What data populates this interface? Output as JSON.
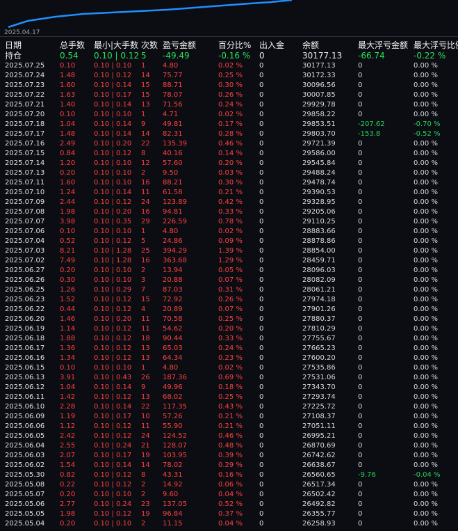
{
  "chart": {
    "start_date": "2025.04.17",
    "line_color": "#1e90ff"
  },
  "colors": {
    "background": "#0b0d12",
    "profit": "#ff4040",
    "loss": "#28e05a"
  },
  "headers": [
    "日期",
    "总手数",
    "最小|大手数",
    "次数",
    "盈亏金额",
    "百分比%",
    "出入金",
    "余额",
    "最大浮亏金额",
    "最大浮亏比例"
  ],
  "hold_row": {
    "date": "持仓",
    "lots": "0.54",
    "minmax": "0.10 | 0.12",
    "count": "5",
    "pnl": "-49.49",
    "pct": "-0.16 %",
    "io": "0",
    "balance": "30177.13",
    "max_float_loss": "-66.74",
    "max_float_ratio": "-0.22 %"
  },
  "rows": [
    [
      "2025.07.25",
      "0.10",
      "0.10 | 0.10",
      "1",
      "4.80",
      "0.02 %",
      "0",
      "30177.13",
      "0",
      "0.00 %"
    ],
    [
      "2025.07.24",
      "1.48",
      "0.10 | 0.12",
      "14",
      "75.77",
      "0.25 %",
      "0",
      "30172.33",
      "0",
      "0.00 %"
    ],
    [
      "2025.07.23",
      "1.60",
      "0.10 | 0.14",
      "15",
      "88.71",
      "0.30 %",
      "0",
      "30096.56",
      "0",
      "0.00 %"
    ],
    [
      "2025.07.22",
      "1.63",
      "0.10 | 0.17",
      "15",
      "78.07",
      "0.26 %",
      "0",
      "30007.85",
      "0",
      "0.00 %"
    ],
    [
      "2025.07.21",
      "1.40",
      "0.10 | 0.14",
      "13",
      "71.56",
      "0.24 %",
      "0",
      "29929.78",
      "0",
      "0.00 %"
    ],
    [
      "2025.07.20",
      "0.10",
      "0.10 | 0.10",
      "1",
      "4.71",
      "0.02 %",
      "0",
      "29858.22",
      "0",
      "0.00 %"
    ],
    [
      "2025.07.18",
      "1.04",
      "0.10 | 0.14",
      "9",
      "49.81",
      "0.17 %",
      "0",
      "29853.51",
      "-207.62",
      "-0.70 %"
    ],
    [
      "2025.07.17",
      "1.48",
      "0.10 | 0.14",
      "14",
      "82.31",
      "0.28 %",
      "0",
      "29803.70",
      "-153.8",
      "-0.52 %"
    ],
    [
      "2025.07.16",
      "2.49",
      "0.10 | 0.20",
      "22",
      "135.39",
      "0.46 %",
      "0",
      "29721.39",
      "0",
      "0.00 %"
    ],
    [
      "2025.07.15",
      "0.84",
      "0.10 | 0.12",
      "8",
      "40.16",
      "0.14 %",
      "0",
      "29586.00",
      "0",
      "0.00 %"
    ],
    [
      "2025.07.14",
      "1.20",
      "0.10 | 0.10",
      "12",
      "57.60",
      "0.20 %",
      "0",
      "29545.84",
      "0",
      "0.00 %"
    ],
    [
      "2025.07.13",
      "0.20",
      "0.10 | 0.10",
      "2",
      "9.50",
      "0.03 %",
      "0",
      "29488.24",
      "0",
      "0.00 %"
    ],
    [
      "2025.07.11",
      "1.60",
      "0.10 | 0.10",
      "16",
      "88.21",
      "0.30 %",
      "0",
      "29478.74",
      "0",
      "0.00 %"
    ],
    [
      "2025.07.10",
      "1.24",
      "0.10 | 0.14",
      "11",
      "61.58",
      "0.21 %",
      "0",
      "29390.53",
      "0",
      "0.00 %"
    ],
    [
      "2025.07.09",
      "2.44",
      "0.10 | 0.12",
      "24",
      "123.89",
      "0.42 %",
      "0",
      "29328.95",
      "0",
      "0.00 %"
    ],
    [
      "2025.07.08",
      "1.98",
      "0.10 | 0.20",
      "16",
      "94.81",
      "0.33 %",
      "0",
      "29205.06",
      "0",
      "0.00 %"
    ],
    [
      "2025.07.07",
      "3.98",
      "0.10 | 0.35",
      "29",
      "226.59",
      "0.78 %",
      "0",
      "29110.25",
      "0",
      "0.00 %"
    ],
    [
      "2025.07.06",
      "0.10",
      "0.10 | 0.10",
      "1",
      "4.80",
      "0.02 %",
      "0",
      "28883.66",
      "0",
      "0.00 %"
    ],
    [
      "2025.07.04",
      "0.52",
      "0.10 | 0.12",
      "5",
      "24.86",
      "0.09 %",
      "0",
      "28878.86",
      "0",
      "0.00 %"
    ],
    [
      "2025.07.03",
      "8.21",
      "0.10 | 1.28",
      "25",
      "394.29",
      "1.39 %",
      "0",
      "28854.00",
      "0",
      "0.00 %"
    ],
    [
      "2025.07.02",
      "7.49",
      "0.10 | 1.28",
      "16",
      "363.68",
      "1.29 %",
      "0",
      "28459.71",
      "0",
      "0.00 %"
    ],
    [
      "2025.06.27",
      "0.20",
      "0.10 | 0.10",
      "2",
      "13.94",
      "0.05 %",
      "0",
      "28096.03",
      "0",
      "0.00 %"
    ],
    [
      "2025.06.26",
      "0.30",
      "0.10 | 0.10",
      "3",
      "20.88",
      "0.07 %",
      "0",
      "28082.09",
      "0",
      "0.00 %"
    ],
    [
      "2025.06.25",
      "1.26",
      "0.10 | 0.29",
      "7",
      "87.03",
      "0.31 %",
      "0",
      "28061.21",
      "0",
      "0.00 %"
    ],
    [
      "2025.06.23",
      "1.52",
      "0.10 | 0.12",
      "15",
      "72.92",
      "0.26 %",
      "0",
      "27974.18",
      "0",
      "0.00 %"
    ],
    [
      "2025.06.22",
      "0.44",
      "0.10 | 0.12",
      "4",
      "20.89",
      "0.07 %",
      "0",
      "27901.26",
      "0",
      "0.00 %"
    ],
    [
      "2025.06.20",
      "1.46",
      "0.10 | 0.20",
      "11",
      "70.58",
      "0.25 %",
      "0",
      "27880.37",
      "0",
      "0.00 %"
    ],
    [
      "2025.06.19",
      "1.14",
      "0.10 | 0.12",
      "11",
      "54.62",
      "0.20 %",
      "0",
      "27810.29",
      "0",
      "0.00 %"
    ],
    [
      "2025.06.18",
      "1.88",
      "0.10 | 0.12",
      "18",
      "90.44",
      "0.33 %",
      "0",
      "27755.67",
      "0",
      "0.00 %"
    ],
    [
      "2025.06.17",
      "1.36",
      "0.10 | 0.12",
      "13",
      "65.03",
      "0.24 %",
      "0",
      "27665.23",
      "0",
      "0.00 %"
    ],
    [
      "2025.06.16",
      "1.34",
      "0.10 | 0.12",
      "13",
      "64.34",
      "0.23 %",
      "0",
      "27600.20",
      "0",
      "0.00 %"
    ],
    [
      "2025.06.15",
      "0.10",
      "0.10 | 0.10",
      "1",
      "4.80",
      "0.02 %",
      "0",
      "27535.86",
      "0",
      "0.00 %"
    ],
    [
      "2025.06.13",
      "3.91",
      "0.10 | 0.43",
      "26",
      "187.36",
      "0.69 %",
      "0",
      "27531.06",
      "0",
      "0.00 %"
    ],
    [
      "2025.06.12",
      "1.04",
      "0.10 | 0.14",
      "9",
      "49.96",
      "0.18 %",
      "0",
      "27343.70",
      "0",
      "0.00 %"
    ],
    [
      "2025.06.11",
      "1.42",
      "0.10 | 0.12",
      "13",
      "68.02",
      "0.25 %",
      "0",
      "27293.74",
      "0",
      "0.00 %"
    ],
    [
      "2025.06.10",
      "2.28",
      "0.10 | 0.14",
      "22",
      "117.35",
      "0.43 %",
      "0",
      "27225.72",
      "0",
      "0.00 %"
    ],
    [
      "2025.06.09",
      "1.19",
      "0.10 | 0.17",
      "10",
      "57.26",
      "0.21 %",
      "0",
      "27108.37",
      "0",
      "0.00 %"
    ],
    [
      "2025.06.06",
      "1.12",
      "0.10 | 0.12",
      "11",
      "55.90",
      "0.21 %",
      "0",
      "27051.11",
      "0",
      "0.00 %"
    ],
    [
      "2025.06.05",
      "2.42",
      "0.10 | 0.12",
      "24",
      "124.52",
      "0.46 %",
      "0",
      "26995.21",
      "0",
      "0.00 %"
    ],
    [
      "2025.06.04",
      "2.55",
      "0.10 | 0.24",
      "21",
      "128.07",
      "0.48 %",
      "0",
      "26870.69",
      "0",
      "0.00 %"
    ],
    [
      "2025.06.03",
      "2.07",
      "0.10 | 0.17",
      "19",
      "103.95",
      "0.39 %",
      "0",
      "26742.62",
      "0",
      "0.00 %"
    ],
    [
      "2025.06.02",
      "1.54",
      "0.10 | 0.14",
      "14",
      "78.02",
      "0.29 %",
      "0",
      "26638.67",
      "0",
      "0.00 %"
    ],
    [
      "2025.05.30",
      "0.82",
      "0.10 | 0.12",
      "8",
      "43.31",
      "0.16 %",
      "0",
      "26560.65",
      "-9.76",
      "-0.04 %"
    ],
    [
      "2025.05.08",
      "0.22",
      "0.10 | 0.12",
      "2",
      "14.92",
      "0.06 %",
      "0",
      "26517.34",
      "0",
      "0.00 %"
    ],
    [
      "2025.05.07",
      "0.20",
      "0.10 | 0.10",
      "2",
      "9.60",
      "0.04 %",
      "0",
      "26502.42",
      "0",
      "0.00 %"
    ],
    [
      "2025.05.06",
      "2.77",
      "0.10 | 0.24",
      "23",
      "137.05",
      "0.52 %",
      "0",
      "26492.82",
      "0",
      "0.00 %"
    ],
    [
      "2025.05.05",
      "1.98",
      "0.10 | 0.12",
      "19",
      "96.84",
      "0.37 %",
      "0",
      "26355.77",
      "0",
      "0.00 %"
    ],
    [
      "2025.05.04",
      "0.20",
      "0.10 | 0.10",
      "2",
      "11.15",
      "0.04 %",
      "0",
      "26258.93",
      "0",
      "0.00 %"
    ]
  ]
}
